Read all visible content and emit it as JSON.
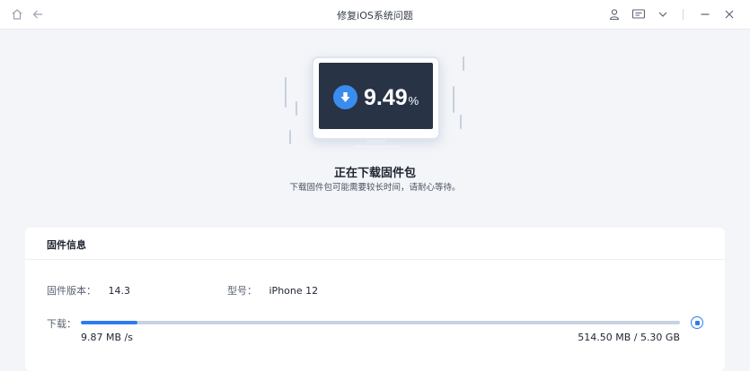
{
  "window": {
    "title": "修复iOS系统问题",
    "icons": [
      "home-icon",
      "back-icon",
      "user-icon",
      "feedback-icon",
      "chevron-down-icon",
      "minimize-icon",
      "close-icon"
    ]
  },
  "hero": {
    "progress_percent": "9.49",
    "percent_unit": "%",
    "status_title": "正在下载固件包",
    "status_subtitle": "下载固件包可能需要较长时间，请耐心等待。"
  },
  "firmware": {
    "header": "固件信息",
    "version_label": "固件版本：",
    "version_value": "14.3",
    "model_label": "型号：",
    "model_value": "iPhone 12",
    "download_label": "下载：",
    "download_progress_fraction": 0.095,
    "speed": "9.87 MB /s",
    "size_progress": "514.50 MB / 5.30 GB"
  },
  "colors": {
    "accent": "#2c7cf0",
    "screen": "#283446",
    "background": "#f3f5f9"
  }
}
